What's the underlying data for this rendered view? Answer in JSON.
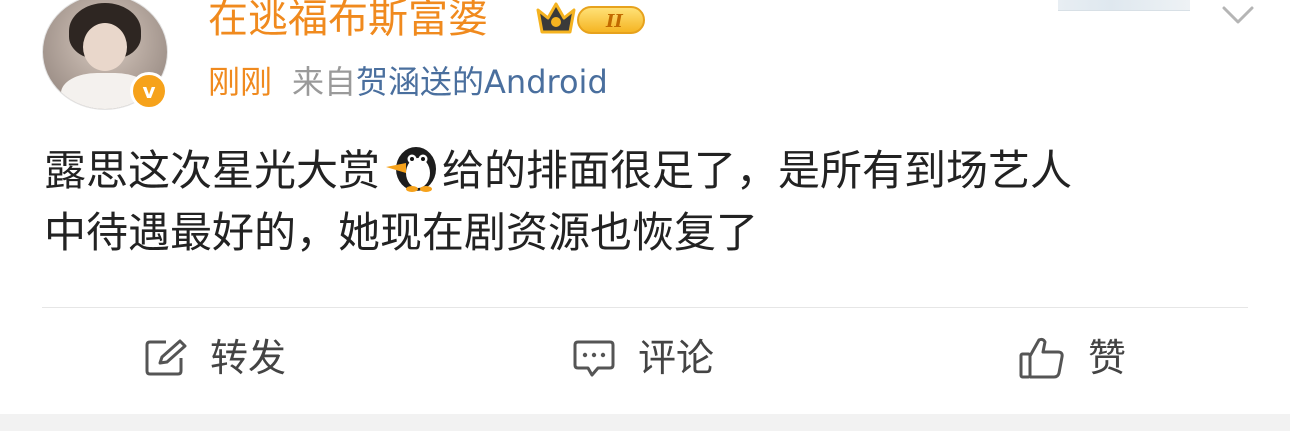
{
  "post": {
    "username": "在逃福布斯富婆",
    "vip_level": "II",
    "time": "刚刚",
    "from_prefix": "来自",
    "source": "贺涵送的Android",
    "content_line1_a": "露思这次星光大赏",
    "content_line1_b": "给的排面很足了，是所有到场艺人",
    "content_line2": "中待遇最好的，她现在剧资源也恢复了",
    "verified_mark": "v"
  },
  "actions": {
    "repost": "转发",
    "comment": "评论",
    "like": "赞"
  },
  "colors": {
    "accent_orange": "#f08a1e",
    "source_blue": "#4a6f9e",
    "meta_gray": "#9a9a9a",
    "text": "#222222"
  },
  "icons": [
    "avatar",
    "verified-badge-icon",
    "vip-crown-badge-icon",
    "chevron-down-icon",
    "penguin-emoji-icon",
    "repost-icon",
    "comment-icon",
    "like-icon"
  ]
}
